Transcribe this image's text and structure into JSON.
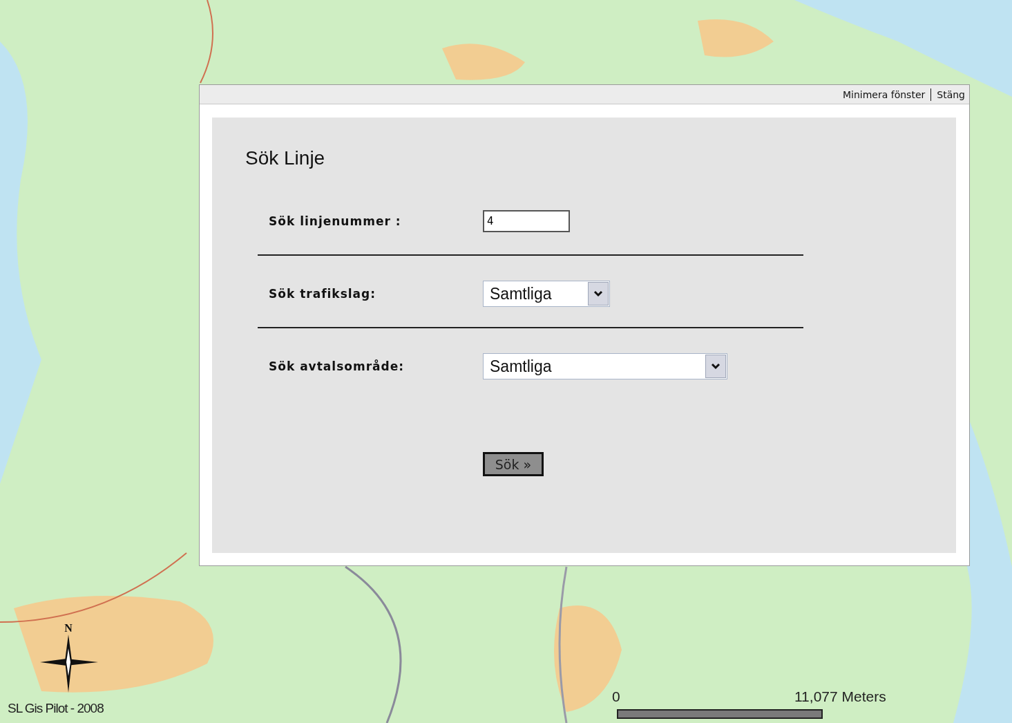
{
  "dialog": {
    "links": [
      "Minimera fönster",
      "Stäng"
    ],
    "title": "Sök Linje",
    "fields": [
      {
        "kind": "text",
        "label": "Sök linjenummer :",
        "value": "4"
      },
      {
        "kind": "select",
        "label": "Sök trafikslag:",
        "value": "Samtliga"
      },
      {
        "kind": "select",
        "label": "Sök avtalsområde:",
        "value": "Samtliga"
      }
    ],
    "button": "Sök »"
  },
  "map": {
    "credit": "SL Gis Pilot - 2008",
    "compass": "N",
    "scale": {
      "start": "0",
      "end": "11,077 Meters"
    }
  }
}
